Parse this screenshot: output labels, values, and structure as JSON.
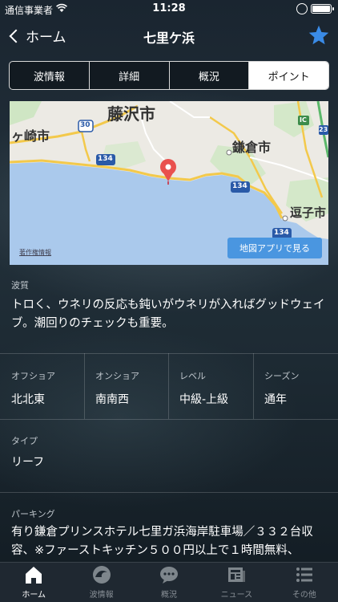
{
  "status_bar": {
    "carrier": "通信事業者",
    "time": "11:28"
  },
  "nav": {
    "back_label": "ホーム",
    "title": "七里ケ浜",
    "favorite_icon": "star-icon",
    "accent_color": "#3a8be6"
  },
  "tabs": [
    {
      "label": "波情報",
      "active": false
    },
    {
      "label": "詳細",
      "active": false
    },
    {
      "label": "概況",
      "active": false
    },
    {
      "label": "ポイント",
      "active": true
    }
  ],
  "map": {
    "labels": {
      "fujisawa": "藤沢市",
      "chigasaki": "ヶ崎市",
      "kamakura": "鎌倉市",
      "zushi": "逗子市",
      "r30": "30",
      "r134a": "134",
      "r134b": "134",
      "r134c": "134",
      "ic": "IC",
      "r23": "23"
    },
    "copyright": "著作権情報",
    "open_button": "地図アプリで見る"
  },
  "wave_quality": {
    "label": "波質",
    "text": "トロく、ウネリの反応も鈍いがウネリが入ればグッドウェイブ。潮回りのチェックも重要。"
  },
  "conditions": [
    {
      "label": "オフショア",
      "value": "北北東"
    },
    {
      "label": "オンショア",
      "value": "南南西"
    },
    {
      "label": "レベル",
      "value": "中級-上級"
    },
    {
      "label": "シーズン",
      "value": "通年"
    }
  ],
  "type": {
    "label": "タイプ",
    "value": "リーフ"
  },
  "parking": {
    "label": "パーキング",
    "text": "有り鎌倉プリンスホテル七里ガ浜海岸駐車場／３３２台収容、※ファーストキッチン５００円以上で１時間無料、"
  },
  "tabbar": [
    {
      "label": "ホーム",
      "icon": "home-icon",
      "active": true
    },
    {
      "label": "波情報",
      "icon": "wave-icon",
      "active": false
    },
    {
      "label": "概況",
      "icon": "chat-bubble-icon",
      "active": false
    },
    {
      "label": "ニュース",
      "icon": "newspaper-icon",
      "active": false
    },
    {
      "label": "その他",
      "icon": "list-icon",
      "active": false
    }
  ]
}
